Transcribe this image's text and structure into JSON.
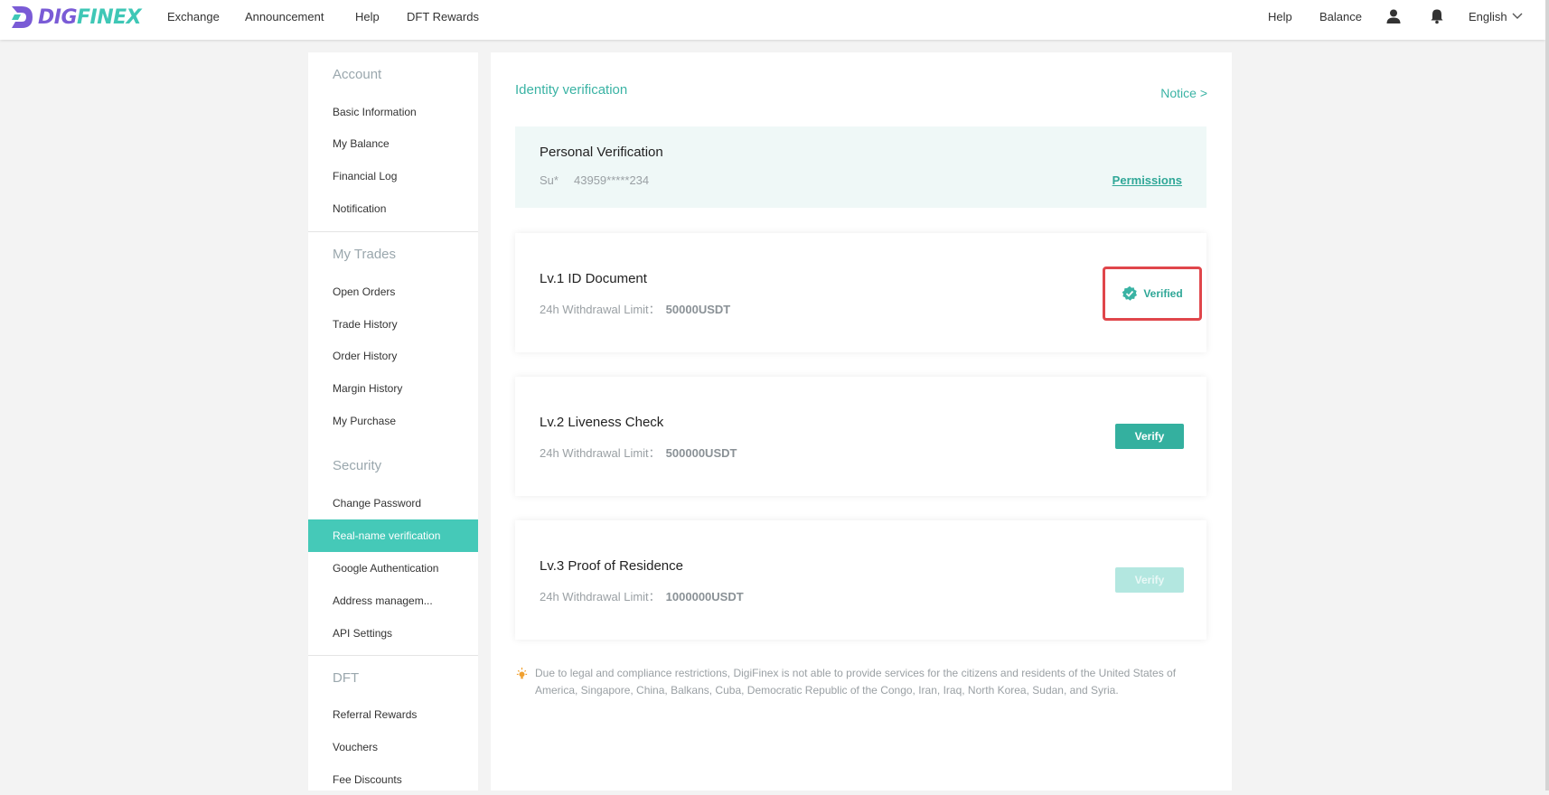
{
  "brand": {
    "part1": "DIG",
    "part2": "FINEX"
  },
  "nav": {
    "exchange": "Exchange",
    "announcement": "Announcement",
    "help": "Help",
    "dft_rewards": "DFT Rewards",
    "help_right": "Help",
    "balance": "Balance",
    "language": "English"
  },
  "sidebar": {
    "account": {
      "heading": "Account",
      "items": [
        "Basic Information",
        "My Balance",
        "Financial Log",
        "Notification"
      ]
    },
    "trades": {
      "heading": "My Trades",
      "items": [
        "Open Orders",
        "Trade History",
        "Order History",
        "Margin History",
        "My Purchase"
      ]
    },
    "security": {
      "heading": "Security",
      "items": [
        "Change Password",
        "Real-name verification",
        "Google Authentication",
        "Address managem...",
        "API Settings"
      ]
    },
    "dft": {
      "heading": "DFT",
      "items": [
        "Referral Rewards",
        "Vouchers",
        "Fee Discounts"
      ]
    }
  },
  "main": {
    "title": "Identity verification",
    "notice": "Notice >",
    "personal": {
      "title": "Personal Verification",
      "name": "Su*",
      "id": "43959*****234",
      "permissions": "Permissions"
    },
    "levels": [
      {
        "title": "Lv.1 ID Document",
        "limit_label": "24h Withdrawal Limit：",
        "limit_value": "50000USDT",
        "status": "Verified"
      },
      {
        "title": "Lv.2 Liveness Check",
        "limit_label": "24h Withdrawal Limit：",
        "limit_value": "500000USDT",
        "button": "Verify"
      },
      {
        "title": "Lv.3 Proof of Residence",
        "limit_label": "24h Withdrawal Limit：",
        "limit_value": "1000000USDT",
        "button": "Verify"
      }
    ],
    "disclaimer": "Due to legal and compliance restrictions, DigiFinex is not able to provide services for the citizens and residents of the United States of America, Singapore, China, Balkans, Cuba, Democratic Republic of the Congo, Iran, Iraq, North Korea, Sudan, and Syria."
  },
  "colors": {
    "accent": "#45c9b8",
    "teal_text": "#3ab3a4",
    "highlight_border": "#e0464b"
  }
}
